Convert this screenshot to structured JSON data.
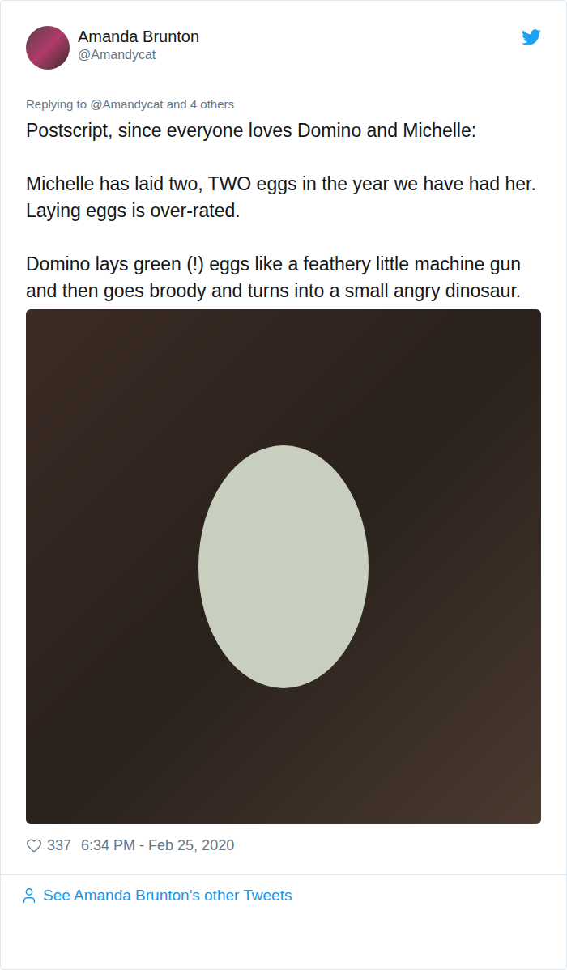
{
  "author": {
    "name": "Amanda Brunton",
    "handle": "@Amandycat"
  },
  "reply_to": "Replying to @Amandycat and 4 others",
  "paragraphs": [
    "Postscript, since everyone loves Domino and Michelle:",
    "Michelle has laid two, TWO eggs in the year we have had her. Laying eggs is over-rated.",
    "Domino lays green (!) eggs like a feathery little machine gun and then goes broody and turns into a small angry dinosaur."
  ],
  "footer": {
    "likes": "337",
    "timestamp": "6:34 PM - Feb 25, 2020",
    "link": "See Amanda Brunton's other Tweets"
  }
}
